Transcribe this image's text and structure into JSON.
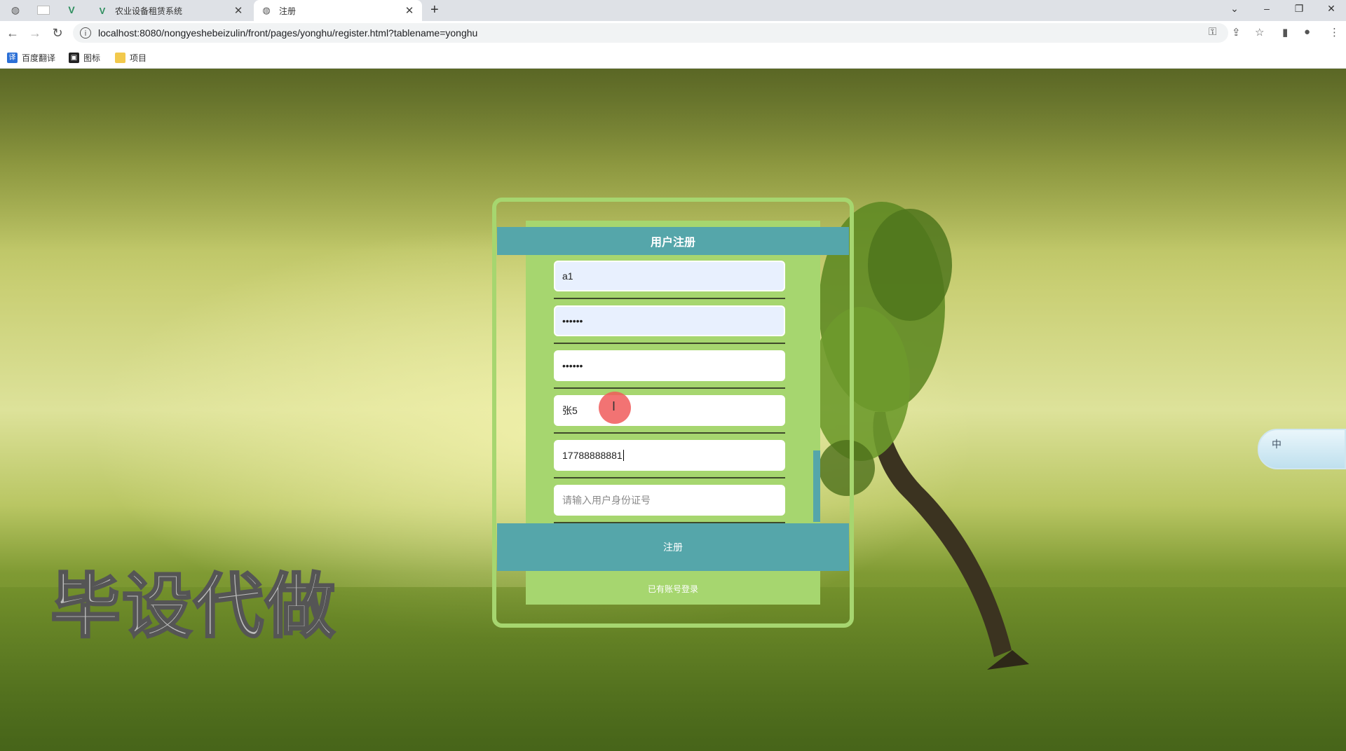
{
  "browser": {
    "tabs": [
      {
        "label": "农业设备租赁系统",
        "active": false,
        "icon": "vue-icon"
      },
      {
        "label": "注册",
        "active": true,
        "icon": "globe-icon"
      }
    ],
    "url": "localhost:8080/nongyeshebeizulin/front/pages/yonghu/register.html?tablename=yonghu",
    "bookmarks": [
      {
        "label": "百度翻译",
        "icon": "translate-icon",
        "color": "#2b6fd6"
      },
      {
        "label": "图标",
        "icon": "image-icon",
        "color": "#222222"
      },
      {
        "label": "项目",
        "icon": "folder-icon",
        "color": "#f2c94c"
      }
    ]
  },
  "form": {
    "title": "用户注册",
    "fields": [
      {
        "name": "account",
        "value": "a1"
      },
      {
        "name": "password",
        "value": "••••••"
      },
      {
        "name": "confirm-password",
        "value": "••••••"
      },
      {
        "name": "username",
        "value": "张5"
      },
      {
        "name": "phone",
        "value": "17788888881"
      },
      {
        "name": "id-number",
        "value": "",
        "placeholder": "请输入用户身份证号"
      }
    ],
    "register_label": "注册",
    "login_link": "已有账号登录"
  },
  "overlay": {
    "watermark": "毕设代做",
    "ime_label": "中"
  },
  "colors": {
    "accent": "#55a6aa",
    "card": "#a6d66f"
  }
}
